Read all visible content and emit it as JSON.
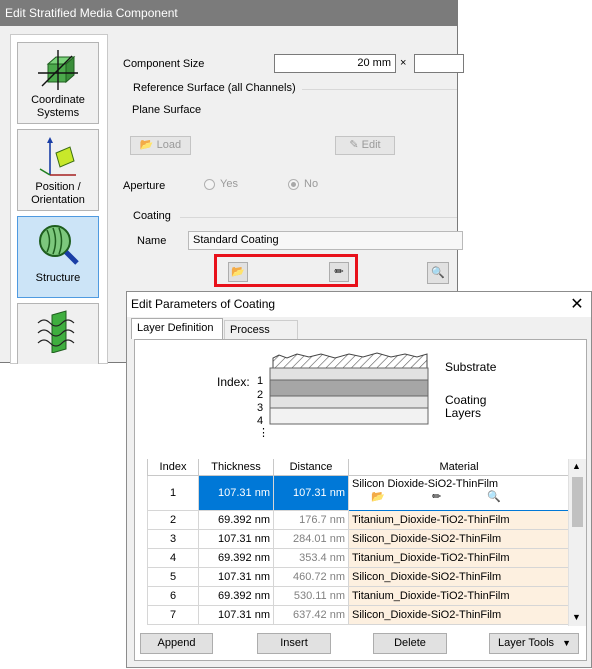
{
  "back_dialog": {
    "title": "Edit Stratified Media Component",
    "sidebar": [
      {
        "label": "Coordinate Systems"
      },
      {
        "label": "Position / Orientation"
      },
      {
        "label": "Structure"
      }
    ],
    "component_size_label": "Component Size",
    "component_size_value": "20 mm",
    "times_sign": "×",
    "reference_surface_label": "Reference Surface (all Channels)",
    "reference_surface_value": "Plane Surface",
    "load_label": "Load",
    "edit_label": "Edit",
    "aperture_label": "Aperture",
    "aperture_yes": "Yes",
    "aperture_no": "No",
    "aperture_selected": "No",
    "coating_label": "Coating",
    "name_label": "Name",
    "name_value": "Standard Coating"
  },
  "front_dialog": {
    "title": "Edit Parameters of Coating",
    "close_icon": "close-icon",
    "tabs": [
      {
        "label": "Layer Definition",
        "active": true
      },
      {
        "label": "Process Data",
        "active": false
      }
    ],
    "diagram": {
      "index_label": "Index:",
      "indices": [
        "1",
        "2",
        "3",
        "4",
        "⋮"
      ],
      "substrate_label": "Substrate",
      "coating_layers_label": "Coating\nLayers"
    },
    "table": {
      "headers": [
        "Index",
        "Thickness",
        "Distance",
        "Material"
      ],
      "rows": [
        {
          "index": "1",
          "thickness": "107.31 nm",
          "distance": "107.31 nm",
          "material": "Silicon  Dioxide-SiO2-ThinFilm",
          "selected": true
        },
        {
          "index": "2",
          "thickness": "69.392 nm",
          "distance": "176.7 nm",
          "material": "Titanium_Dioxide-TiO2-ThinFilm"
        },
        {
          "index": "3",
          "thickness": "107.31 nm",
          "distance": "284.01 nm",
          "material": "Silicon_Dioxide-SiO2-ThinFilm"
        },
        {
          "index": "4",
          "thickness": "69.392 nm",
          "distance": "353.4 nm",
          "material": "Titanium_Dioxide-TiO2-ThinFilm"
        },
        {
          "index": "5",
          "thickness": "107.31 nm",
          "distance": "460.72 nm",
          "material": "Silicon_Dioxide-SiO2-ThinFilm"
        },
        {
          "index": "6",
          "thickness": "69.392 nm",
          "distance": "530.11 nm",
          "material": "Titanium_Dioxide-TiO2-ThinFilm"
        },
        {
          "index": "7",
          "thickness": "107.31 nm",
          "distance": "637.42 nm",
          "material": "Silicon_Dioxide-SiO2-ThinFilm"
        }
      ]
    },
    "buttons": {
      "append": "Append",
      "insert": "Insert",
      "delete": "Delete",
      "layer_tools": "Layer Tools"
    }
  },
  "colors": {
    "selection": "#0078d7",
    "material_cell": "#fdf0e0",
    "highlight_box": "#e8101a",
    "selected_sidebar": "#cce4f7"
  }
}
